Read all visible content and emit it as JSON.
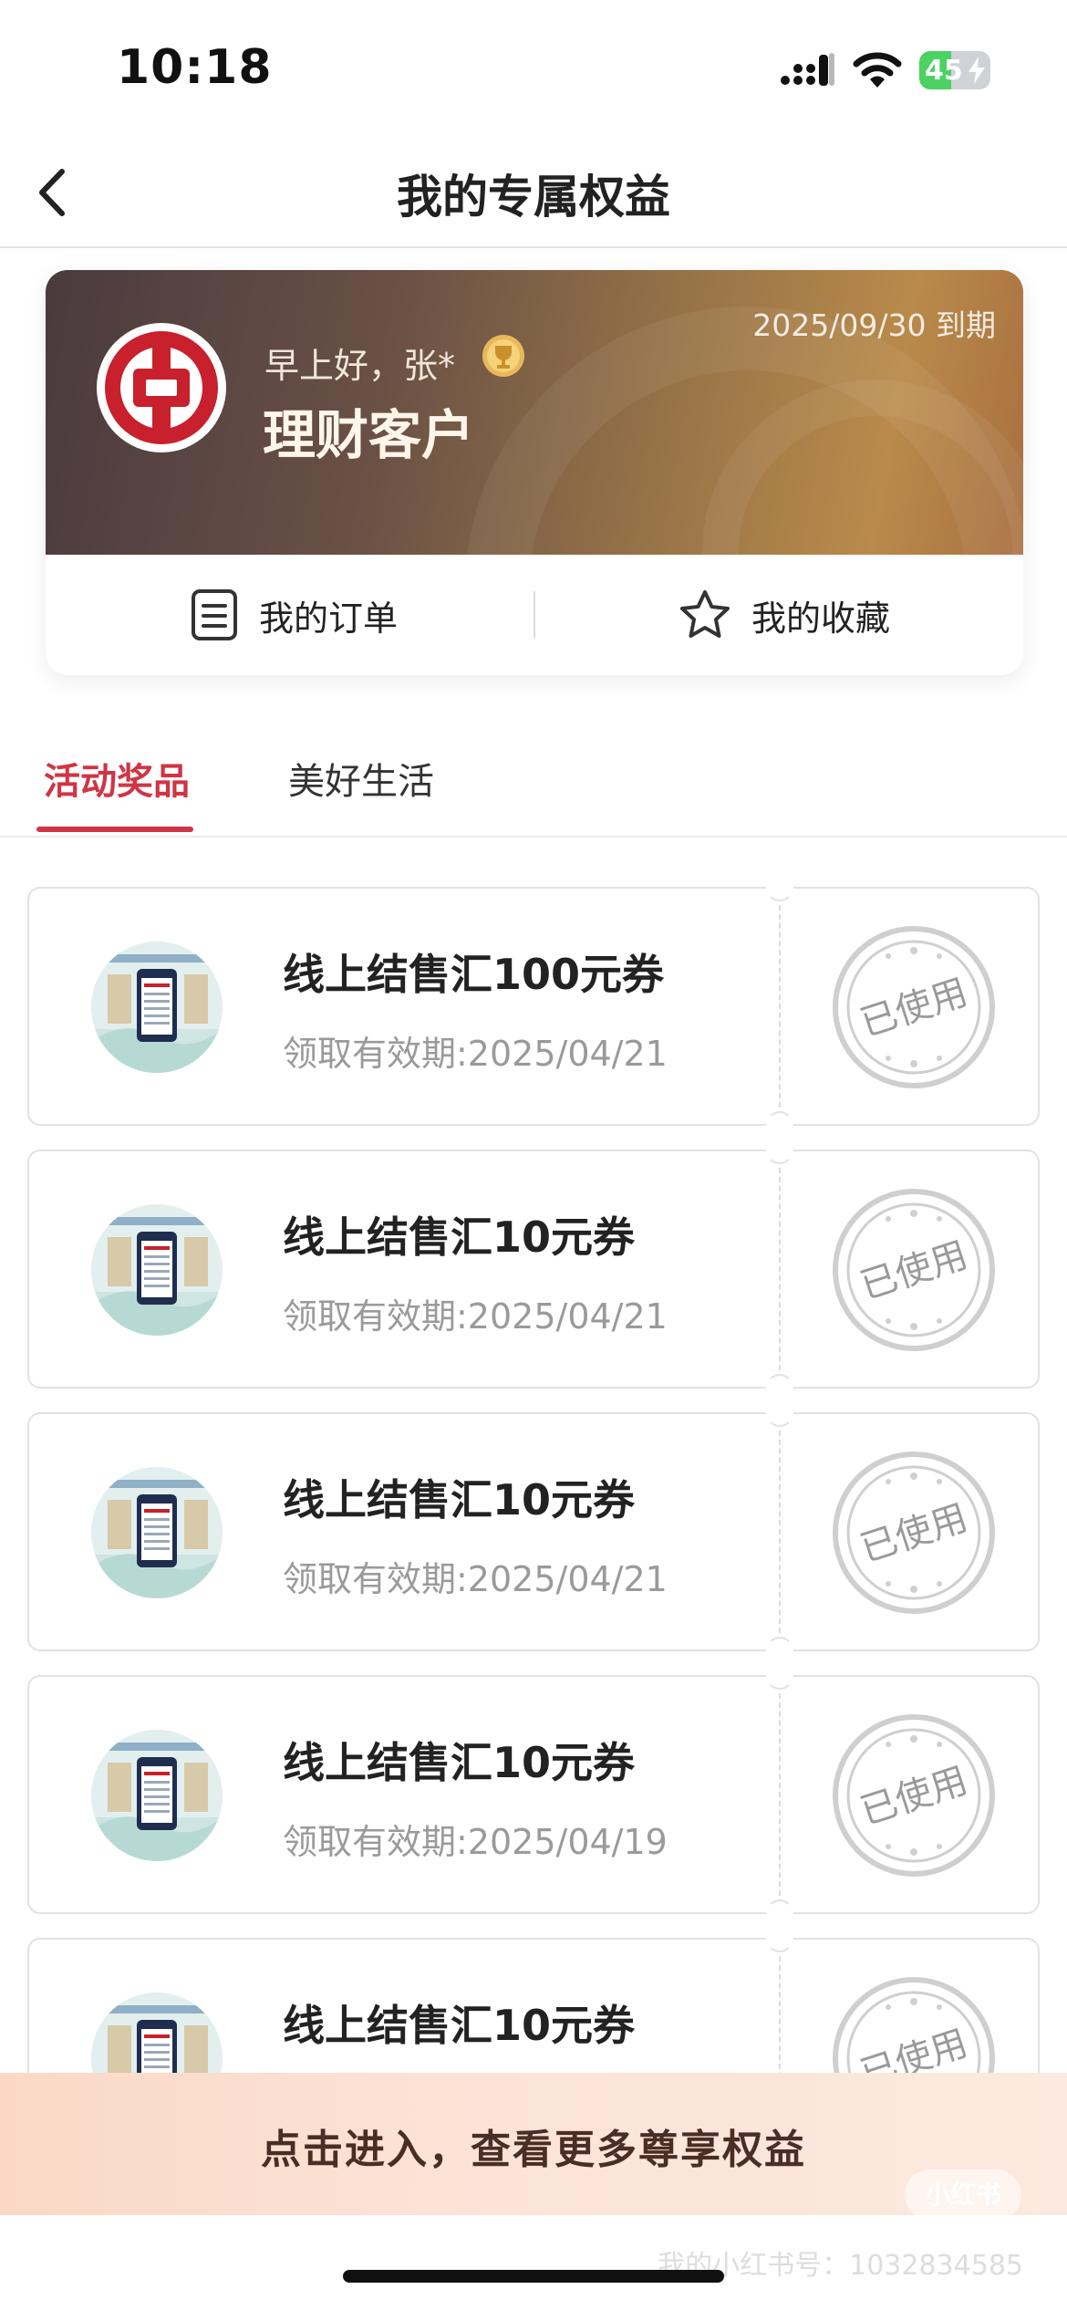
{
  "status_bar": {
    "time": "10:18",
    "battery": "45",
    "battery_level": 0.45
  },
  "nav": {
    "title": "我的专属权益"
  },
  "member_card": {
    "greeting": "早上好，张*",
    "level": "理财客户",
    "expiry": "2025/09/30 到期",
    "actions": {
      "orders": "我的订单",
      "favorites": "我的收藏"
    }
  },
  "tabs": [
    {
      "label": "活动奖品",
      "active": true
    },
    {
      "label": "美好生活",
      "active": false
    }
  ],
  "coupons": [
    {
      "title": "线上结售汇100元券",
      "date": "领取有效期:2025/04/21",
      "status": "已使用"
    },
    {
      "title": "线上结售汇10元券",
      "date": "领取有效期:2025/04/21",
      "status": "已使用"
    },
    {
      "title": "线上结售汇10元券",
      "date": "领取有效期:2025/04/21",
      "status": "已使用"
    },
    {
      "title": "线上结售汇10元券",
      "date": "领取有效期:2025/04/19",
      "status": "已使用"
    },
    {
      "title": "线上结售汇10元券",
      "date": "",
      "status": "已使用"
    }
  ],
  "bottom_banner": {
    "text": "点击进入，查看更多尊享权益"
  },
  "watermark": {
    "badge": "小红书",
    "text": "我的小红书号：1032834585"
  },
  "colors": {
    "accent": "#d03545",
    "card_gold": "#b98a4a",
    "stamp_gray": "#c8c8c8"
  }
}
